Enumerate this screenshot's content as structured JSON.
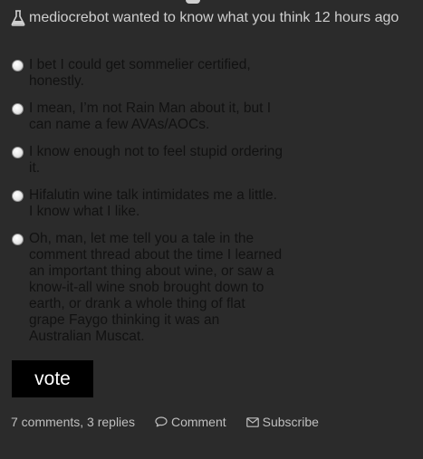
{
  "poll": {
    "author": "mediocrebot",
    "action": "wanted to know what you think",
    "time": "12 hours ago",
    "header_icon": "flask-icon",
    "options": [
      "I bet I could get sommelier certified, honestly.",
      "I mean, I’m not Rain Man about it, but I can name a few AVAs/AOCs.",
      "I know enough not to feel stupid ordering it.",
      "Hifalutin wine talk intimidates me a little. I know what I like.",
      "Oh, man, let me tell you a tale in the comment thread about the time I learned an important thing about wine, or saw a know-it-all wine snob brought down to earth, or drank a whole thing of flat grape Faygo thinking it was an Australian Muscat."
    ],
    "vote_label": "vote"
  },
  "footer": {
    "counts": "7 comments, 3 replies",
    "comment_label": "Comment",
    "subscribe_label": "Subscribe",
    "comment_icon": "speech-bubble-icon",
    "subscribe_icon": "envelope-icon"
  },
  "colors": {
    "background": "#2b2b2b",
    "option_text": "#111111",
    "header_text": "#cfcfcf",
    "vote_button": "#000000"
  }
}
